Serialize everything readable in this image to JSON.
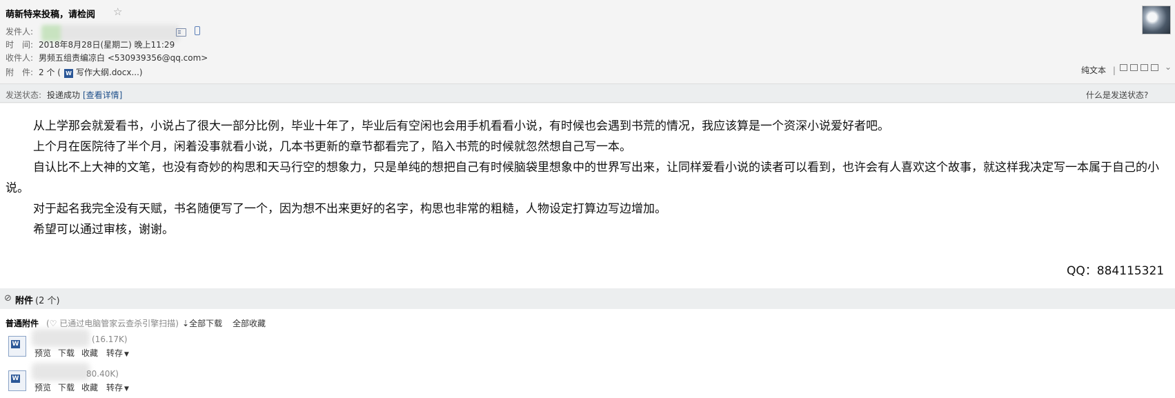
{
  "header": {
    "subject": "萌新特来投稿，请检阅",
    "star_glyph": "☆",
    "sender_label": "发件人:",
    "time_label": "时　间:",
    "time_value": "2018年8月28日(星期二) 晚上11:29",
    "to_label": "收件人:",
    "to_value": "男频五组责编凉白 <530939356@qq.com>",
    "attach_label": "附　件:",
    "attach_prefix": "2 个 (",
    "attach_filename": "写作大纲.docx...)"
  },
  "toolbar": {
    "plain_text": "纯文本",
    "separator": "|"
  },
  "status": {
    "label": "发送状态:",
    "value": "投递成功",
    "details_link": "[查看详情]",
    "help_link": "什么是发送状态?"
  },
  "body": {
    "paragraphs": [
      "从上学那会就爱看书，小说占了很大一部分比例，毕业十年了，毕业后有空闲也会用手机看看小说，有时候也会遇到书荒的情况，我应该算是一个资深小说爱好者吧。",
      "上个月在医院待了半个月，闲着没事就看小说，几本书更新的章节都看完了，陷入书荒的时候就忽然想自己写一本。",
      "自认比不上大神的文笔，也没有奇妙的构思和天马行空的想象力，只是单纯的想把自己有时候脑袋里想象中的世界写出来，让同样爱看小说的读者可以看到，也许会有人喜欢这个故事，就这样我决定写一本属于自己的小说。",
      "对于起名我完全没有天赋，书名随便写了一个，因为想不出来更好的名字，构思也非常的粗糙，人物设定打算边写边增加。",
      "希望可以通过审核，谢谢。"
    ],
    "qq": "QQ：884115321"
  },
  "attachments": {
    "title": "附件",
    "count": "(2 个)",
    "ordinary_label": "普通附件",
    "scan_note": "(♡ 已通过电脑管家云查杀引擎扫描)",
    "download_all": "全部下载",
    "favorite_all": "全部收藏",
    "files": [
      {
        "size": "(16.17K)",
        "preview": "预览",
        "download": "下载",
        "favorite": "收藏",
        "forward": "转存"
      },
      {
        "size": "80.40K)",
        "preview": "预览",
        "download": "下载",
        "favorite": "收藏",
        "forward": "转存"
      }
    ]
  }
}
